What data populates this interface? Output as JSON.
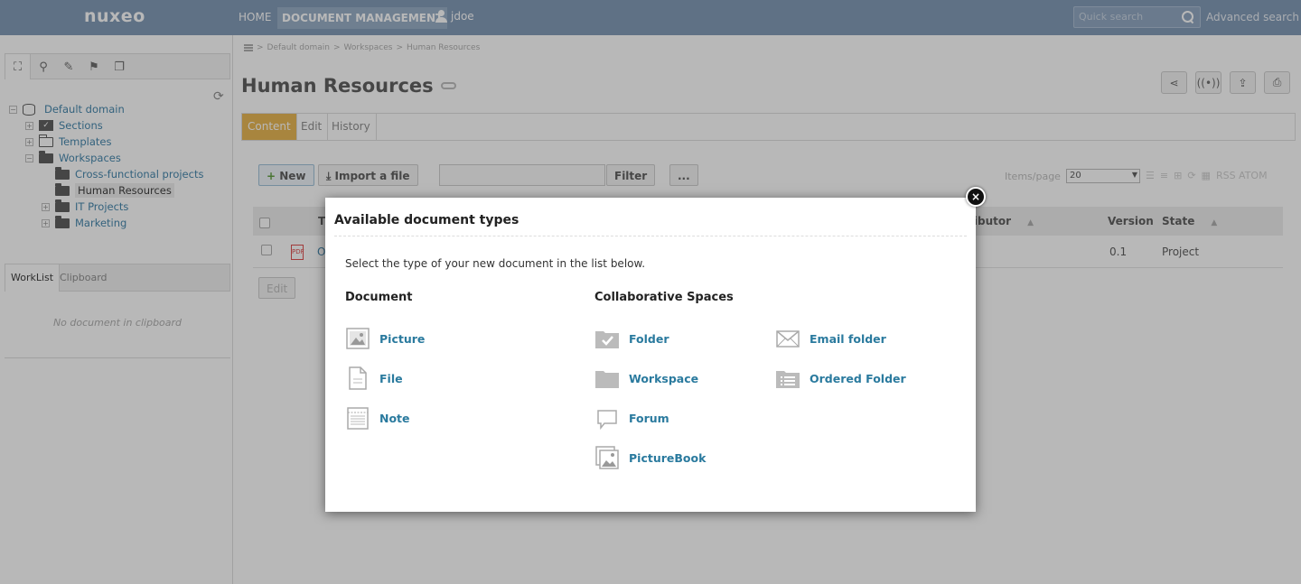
{
  "topbar": {
    "logo": "nuxeo",
    "nav_home": "HOME",
    "nav_document_management": "DOCUMENT MANAGEMENT",
    "user": "jdoe",
    "quick_search_placeholder": "Quick search",
    "advanced_search": "Advanced search"
  },
  "sidebar": {
    "tree": {
      "root": "Default domain",
      "sections": "Sections",
      "templates": "Templates",
      "workspaces": "Workspaces",
      "cross_functional": "Cross-functional projects",
      "human_resources": "Human Resources",
      "it_projects": "IT Projects",
      "marketing": "Marketing"
    },
    "tabs": {
      "worklist": "WorkList",
      "clipboard": "Clipboard"
    },
    "clipboard_empty": "No document in clipboard"
  },
  "main": {
    "breadcrumb": [
      "Default domain",
      "Workspaces",
      "Human Resources"
    ],
    "title": "Human Resources",
    "tabs": {
      "content": "Content",
      "edit": "Edit",
      "history": "History"
    },
    "buttons": {
      "new": "New",
      "import": "Import a file",
      "filter": "Filter",
      "more": "...",
      "edit": "Edit"
    },
    "items_per_page_label": "Items/page",
    "items_per_page_value": "20",
    "feeds": "RSS ATOM",
    "table": {
      "col_title_partial": "T",
      "col_contributor_partial": "ributor",
      "col_version": "Version",
      "col_state": "State",
      "row": {
        "title_partial": "O",
        "version": "0.1",
        "state": "Project"
      }
    }
  },
  "modal": {
    "title": "Available document types",
    "description": "Select the type of your new document in the list below.",
    "document_heading": "Document",
    "collab_heading": "Collaborative Spaces",
    "document_types": [
      "Picture",
      "File",
      "Note"
    ],
    "collab_types_col1": [
      "Folder",
      "Workspace",
      "Forum",
      "PictureBook"
    ],
    "collab_types_col2": [
      "Email folder",
      "Ordered Folder"
    ],
    "close": "×"
  }
}
